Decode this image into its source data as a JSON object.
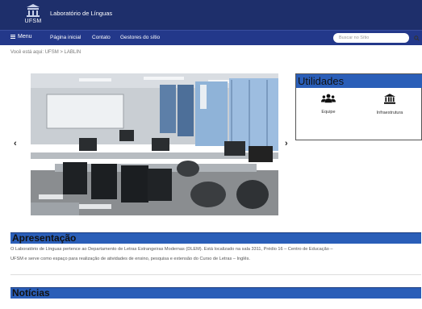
{
  "header": {
    "logo_text": "UFSM",
    "site_title": "Laboratório de Línguas"
  },
  "nav": {
    "menu_label": "Menu",
    "links": [
      "Página inicial",
      "Contato",
      "Gestores do sítio"
    ],
    "search_placeholder": "Buscar no Sítio"
  },
  "breadcrumb": "Você está aqui: UFSM > LABLIN",
  "carousel": {
    "prev": "‹",
    "next": "›"
  },
  "utilidades": {
    "title": "Utilidades",
    "items": [
      {
        "label": "Equipe",
        "icon": "users-icon"
      },
      {
        "label": "Infraestrutura",
        "icon": "building-columns-icon"
      }
    ]
  },
  "apresentacao": {
    "title": "Apresentação",
    "line1": "O Laboratório de Línguas pertence ao Departamento de Letras Estrangeiras Modernas (DLEM). Está localizado na sala 3311, Prédio 16 – Centro de Educação –",
    "line2": "UFSM e serve como espaço para realização de atividades de ensino, pesquisa e extensão do Curso de Letras – Inglês."
  },
  "noticias": {
    "title": "Notícias"
  },
  "colors": {
    "topbar": "#1e2f6b",
    "navbar": "#23388a",
    "section_bar": "#2a5eb8"
  }
}
